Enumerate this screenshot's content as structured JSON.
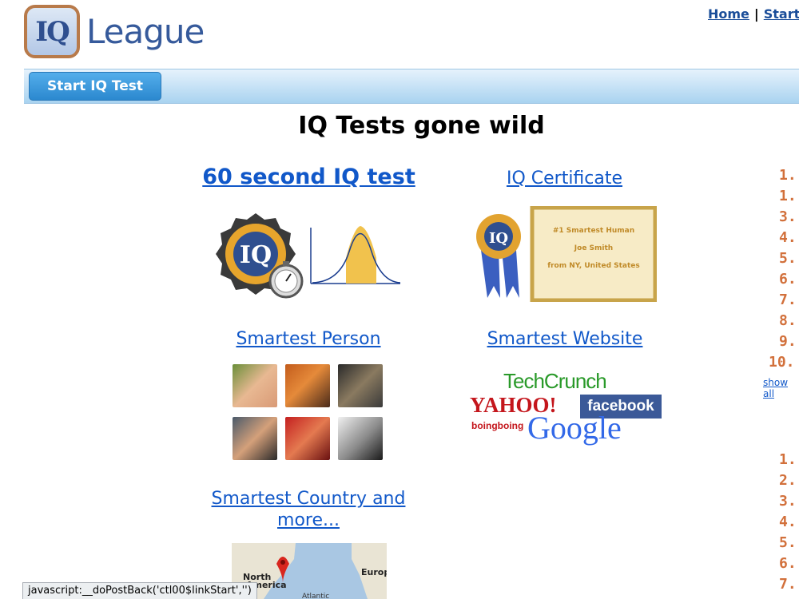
{
  "logo": {
    "mark": "IQ",
    "wordmark": "League"
  },
  "topnav": {
    "home": "Home",
    "separator": "|",
    "start": "Start"
  },
  "navbar": {
    "start_button": "Start IQ Test"
  },
  "headline": "IQ Tests gone wild",
  "sections": {
    "iq_test": {
      "label": "60 second IQ test"
    },
    "certificate": {
      "label": "IQ Certificate",
      "line1": "#1 Smartest Human",
      "line2": "Joe Smith",
      "line3": "from NY, United States"
    },
    "smartest_person": {
      "label": "Smartest Person"
    },
    "smartest_website": {
      "label": "Smartest Website",
      "logos": [
        "TechCrunch",
        "YAHOO!",
        "facebook",
        "boingboing",
        "Google"
      ]
    },
    "smartest_country": {
      "label_line1": "Smartest Country and",
      "label_line2": "more...",
      "map_labels": [
        "North",
        "America",
        "Europ",
        "Atlantic"
      ]
    }
  },
  "ranking_top": [
    "1.",
    "1.",
    "3.",
    "4.",
    "5.",
    "6.",
    "7.",
    "8.",
    "9.",
    "10."
  ],
  "show_all": "show all",
  "ranking_bottom": [
    "1.",
    "2.",
    "3.",
    "4.",
    "5.",
    "6.",
    "7."
  ],
  "status_bar": "javascript:__doPostBack('ctl00$linkStart','')",
  "colors": {
    "accent": "#1158c9",
    "rank": "#d2703b",
    "nav_blue": "#2b88cf"
  }
}
